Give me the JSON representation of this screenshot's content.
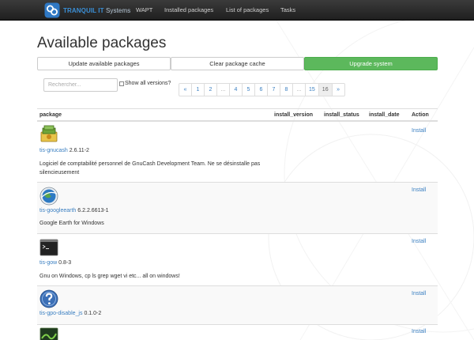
{
  "navbar": {
    "brand_name": "TRANQUIL IT",
    "brand_suffix": "Systems",
    "items": [
      {
        "label": "WAPT"
      },
      {
        "label": "Installed packages"
      },
      {
        "label": "List of packages"
      },
      {
        "label": "Tasks"
      }
    ]
  },
  "page": {
    "title": "Available packages"
  },
  "actions": {
    "update": "Update available packages",
    "clear_cache": "Clear package cache",
    "upgrade": "Upgrade system",
    "upgrade_color": "#5cb85c"
  },
  "search": {
    "placeholder": "Rechercher...",
    "value": "",
    "show_all_label": "Show all versions?",
    "show_all_checked": false
  },
  "pagination": {
    "prev": "«",
    "pages": [
      "1",
      "2",
      "...",
      "4",
      "5",
      "6",
      "7",
      "8",
      "...",
      "15",
      "16"
    ],
    "next": "»",
    "active": "16"
  },
  "table": {
    "headers": {
      "package": "package",
      "install_version": "install_version",
      "install_status": "install_status",
      "install_date": "install_date",
      "action": "Action"
    },
    "rows": [
      {
        "icon": "gnucash-icon",
        "name": "tis-gnucash",
        "version": "2.6.11-2",
        "description": "Logiciel de comptabilité personnel de GnuCash Development Team. Ne se désinstalle pas silencieusement",
        "action": "Install"
      },
      {
        "icon": "google-earth-icon",
        "name": "tis-googleearth",
        "version": "6.2.2.6613-1",
        "description": "Google Earth for Windows",
        "action": "Install"
      },
      {
        "icon": "terminal-icon",
        "name": "tis-gow",
        "version": "0.8-3",
        "description": "Gnu on Windows, cp ls grep wget vi etc... all on windows!",
        "action": "Install"
      },
      {
        "icon": "question-icon",
        "name": "tis-gpo-disable_js",
        "version": "0.1.0-2",
        "description": "",
        "action": "Install"
      },
      {
        "icon": "green-app-icon",
        "name": "",
        "version": "",
        "description": "",
        "action": "Install"
      }
    ]
  }
}
